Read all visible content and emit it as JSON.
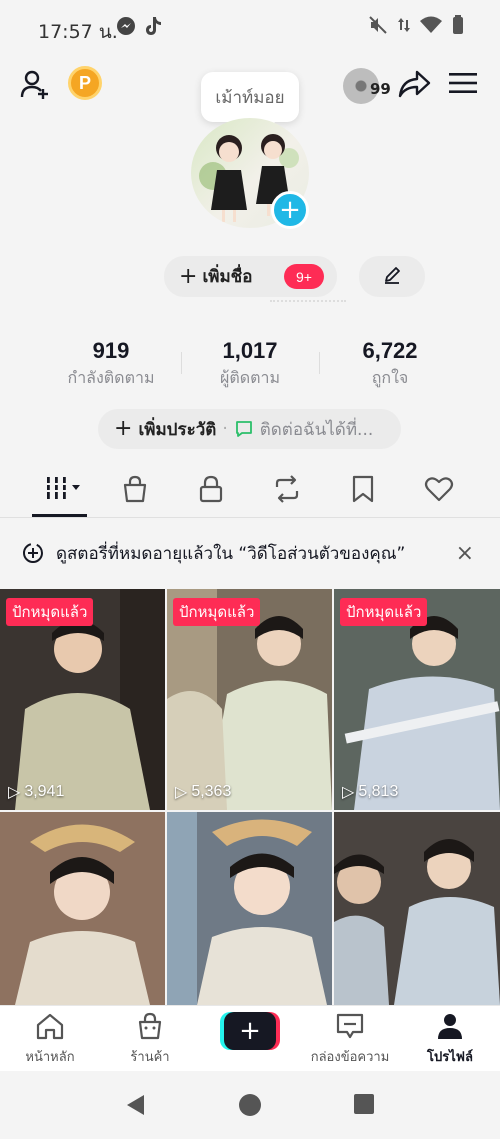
{
  "status_bar": {
    "time": "17:57 น."
  },
  "top_bar": {
    "coin_letter": "P",
    "music_count": "99",
    "icons": [
      "add-friend-icon",
      "coin-icon",
      "music-disc-icon",
      "share-icon",
      "menu-icon"
    ]
  },
  "profile": {
    "name_tooltip": "เม้าท์มอย",
    "add_name_label": "เพิ่มชื่อ",
    "notification_badge": "9+"
  },
  "stats": [
    {
      "value": "919",
      "label": "กำลังติดตาม"
    },
    {
      "value": "1,017",
      "label": "ผู้ติดตาม"
    },
    {
      "value": "6,722",
      "label": "ถูกใจ"
    }
  ],
  "bio": {
    "add_bio_label": "เพิ่มประวัติ",
    "contact_label": "ติดต่อฉันได้ที่..."
  },
  "tabs": [
    "videos-grid-icon",
    "shop-bag-icon",
    "lock-icon",
    "repost-icon",
    "bookmark-icon",
    "heart-icon"
  ],
  "notice": {
    "text": "ดูสตอรี่ที่หมดอายุแล้วใน “วิดีโอส่วนตัวของคุณ”"
  },
  "videos": [
    {
      "pinned": "ปักหมุดแล้ว",
      "views": "3,941"
    },
    {
      "pinned": "ปักหมุดแล้ว",
      "views": "5,363"
    },
    {
      "pinned": "ปักหมุดแล้ว",
      "views": "5,813"
    },
    {
      "pinned": "",
      "views": ""
    },
    {
      "pinned": "",
      "views": ""
    },
    {
      "pinned": "",
      "views": ""
    }
  ],
  "bottom_nav": {
    "home": "หน้าหลัก",
    "shop": "ร้านค้า",
    "inbox": "กล่องข้อความ",
    "profile": "โปรไฟล์"
  },
  "colors": {
    "accent_red": "#fe2c55",
    "accent_cyan": "#25f4ee",
    "avatar_plus": "#20b8e6",
    "coin": "#f5a623"
  }
}
